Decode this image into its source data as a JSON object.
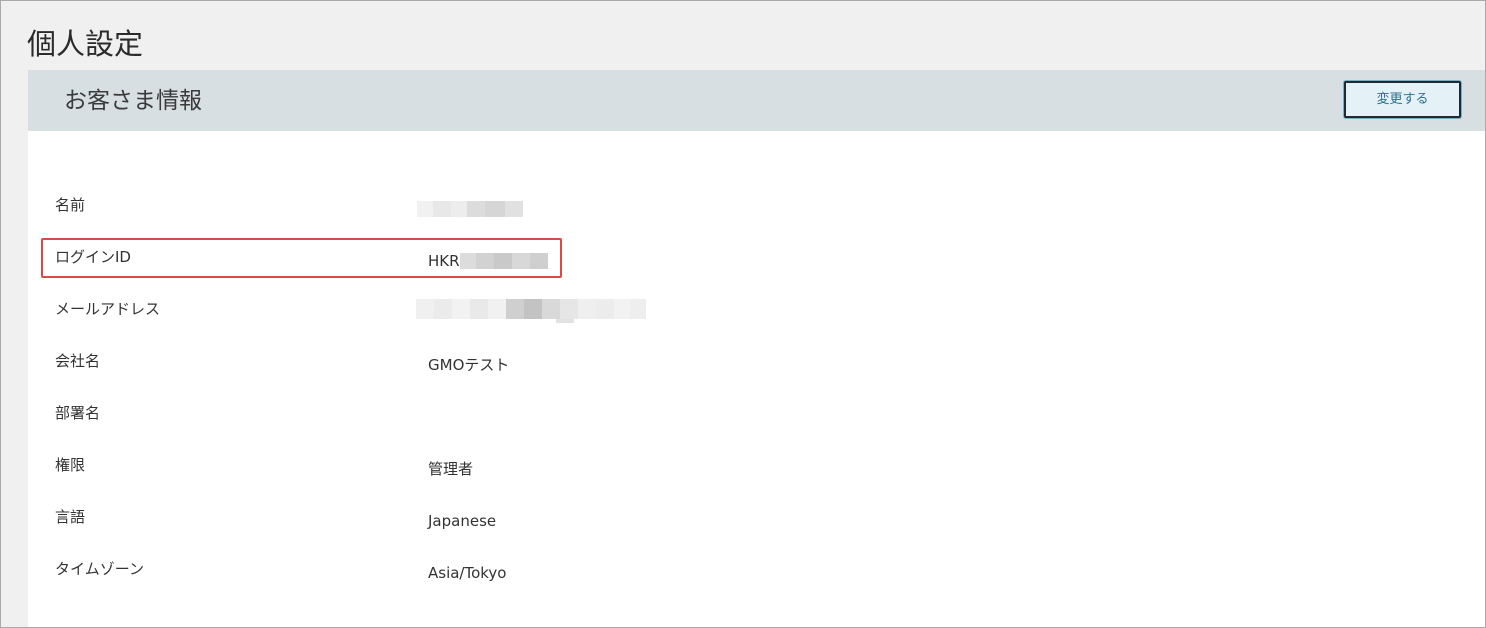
{
  "page": {
    "title": "個人設定"
  },
  "card": {
    "title": "お客さま情報",
    "change_button_label": "変更する"
  },
  "rows": [
    {
      "label": "名前",
      "value": ""
    },
    {
      "label": "ログインID",
      "value": "HKR"
    },
    {
      "label": "メールアドレス",
      "value": ""
    },
    {
      "label": "会社名",
      "value": "GMOテスト"
    },
    {
      "label": "部署名",
      "value": ""
    },
    {
      "label": "権限",
      "value": "管理者"
    },
    {
      "label": "言語",
      "value": "Japanese"
    },
    {
      "label": "タイムゾーン",
      "value": "Asia/Tokyo"
    }
  ],
  "colors": {
    "header_band": "#d7dfe2",
    "highlight": "#e04848",
    "button_text": "#2a6f8f"
  }
}
